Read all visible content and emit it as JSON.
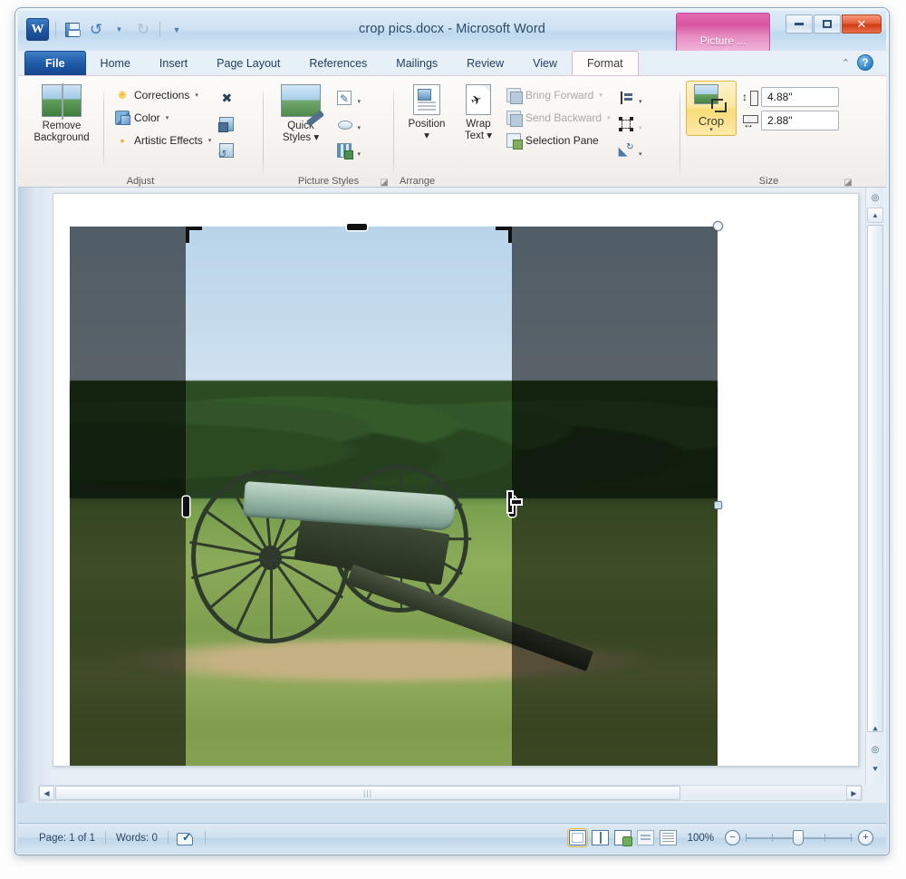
{
  "window": {
    "title": "crop pics.docx  -  Microsoft Word",
    "app_icon": "W",
    "contextual_tab_group": "Picture ...",
    "buttons": {
      "minimize": "minimize-button",
      "restore": "restore-button",
      "close": "✕"
    }
  },
  "quick_access": {
    "save": "save-icon",
    "undo": "↺",
    "undo_dropdown": "▾",
    "redo": "↻",
    "customize": "▾"
  },
  "ribbon": {
    "help": {
      "collapse": "⌃",
      "help": "?"
    },
    "tabs": [
      {
        "label": "File",
        "id": "file"
      },
      {
        "label": "Home",
        "id": "home"
      },
      {
        "label": "Insert",
        "id": "insert"
      },
      {
        "label": "Page Layout",
        "id": "page-layout"
      },
      {
        "label": "References",
        "id": "references"
      },
      {
        "label": "Mailings",
        "id": "mailings"
      },
      {
        "label": "Review",
        "id": "review"
      },
      {
        "label": "View",
        "id": "view"
      },
      {
        "label": "Format",
        "id": "format"
      }
    ],
    "groups": [
      {
        "name": "Adjust",
        "label": "Adjust",
        "big_button": {
          "label_line1": "Remove",
          "label_line2": "Background",
          "icon": "remove-background-icon"
        },
        "small_buttons": [
          {
            "label": "Corrections",
            "icon": "corrections-icon",
            "arrow": "▾",
            "disabled": false
          },
          {
            "label": "Color",
            "icon": "color-icon",
            "arrow": "▾",
            "disabled": false
          },
          {
            "label": "Artistic Effects",
            "icon": "artistic-effects-icon",
            "arrow": "▾",
            "disabled": false
          }
        ],
        "icon_buttons": [
          {
            "name": "compress-pictures-icon"
          },
          {
            "name": "change-picture-icon"
          },
          {
            "name": "reset-picture-icon"
          }
        ]
      },
      {
        "name": "Picture Styles",
        "label": "Picture Styles",
        "dialog_launcher": "◪",
        "big_button": {
          "label_line1": "Quick",
          "label_line2": "Styles ▾",
          "icon": "quick-styles-icon"
        },
        "icon_buttons": [
          {
            "name": "picture-border-icon",
            "arrow": "▾"
          },
          {
            "name": "picture-effects-icon",
            "arrow": "▾"
          },
          {
            "name": "picture-layout-icon",
            "arrow": "▾"
          }
        ]
      },
      {
        "name": "Arrange",
        "label": "Arrange",
        "big_buttons": [
          {
            "label_line1": "Position",
            "label_line2": "▾",
            "icon": "position-icon"
          },
          {
            "label_line1": "Wrap",
            "label_line2": "Text ▾",
            "icon": "wrap-text-icon"
          }
        ],
        "small_buttons": [
          {
            "label": "Bring Forward",
            "icon": "bring-forward-icon",
            "arrow": "▾",
            "disabled": true
          },
          {
            "label": "Send Backward",
            "icon": "send-backward-icon",
            "arrow": "▾",
            "disabled": true
          },
          {
            "label": "Selection Pane",
            "icon": "selection-pane-icon",
            "arrow": "",
            "disabled": false
          }
        ],
        "icon_buttons": [
          {
            "name": "align-icon",
            "arrow": "▾",
            "disabled": false
          },
          {
            "name": "group-icon",
            "arrow": "▾",
            "disabled": true
          },
          {
            "name": "rotate-icon",
            "arrow": "▾",
            "disabled": false
          }
        ]
      },
      {
        "name": "Size",
        "label": "Size",
        "dialog_launcher": "◪",
        "crop_button": {
          "label": "Crop",
          "arrow": "▾",
          "icon": "crop-icon",
          "state": "active"
        },
        "fields": [
          {
            "name": "shape-height",
            "icon": "shape-height-icon",
            "value": "4.88\""
          },
          {
            "name": "shape-width",
            "icon": "shape-width-icon",
            "value": "2.88\""
          }
        ],
        "spinner_up": "▲",
        "spinner_down": "▼"
      }
    ]
  },
  "document": {
    "picture": {
      "alt": "photograph of a civil war cannon on a grassy battlefield with a tree line",
      "cropping": true,
      "crop_handles": [
        "top-left",
        "top-center",
        "top-right",
        "middle-left",
        "middle-right",
        "bottom-left",
        "bottom-center",
        "bottom-right"
      ],
      "cursor": "crop-resize-cursor"
    }
  },
  "scrollbars": {
    "vertical": {
      "up_arrow": "▲",
      "down_arrow": "▼",
      "prev_page": "⯅",
      "select_object": "◎",
      "next_page": "⯆"
    },
    "horizontal": {
      "left_arrow": "◀",
      "right_arrow": "▶",
      "grip": "|||"
    }
  },
  "statusbar": {
    "page": "Page: 1 of 1",
    "words": "Words: 0",
    "proofing_icon": "proofing-errors-icon",
    "view_buttons": [
      {
        "name": "print-layout-view",
        "active": true
      },
      {
        "name": "full-screen-reading-view",
        "active": false
      },
      {
        "name": "web-layout-view",
        "active": false
      },
      {
        "name": "outline-view",
        "active": false
      },
      {
        "name": "draft-view",
        "active": false
      }
    ],
    "zoom_level": "100%",
    "zoom_out": "−",
    "zoom_in": "+"
  }
}
